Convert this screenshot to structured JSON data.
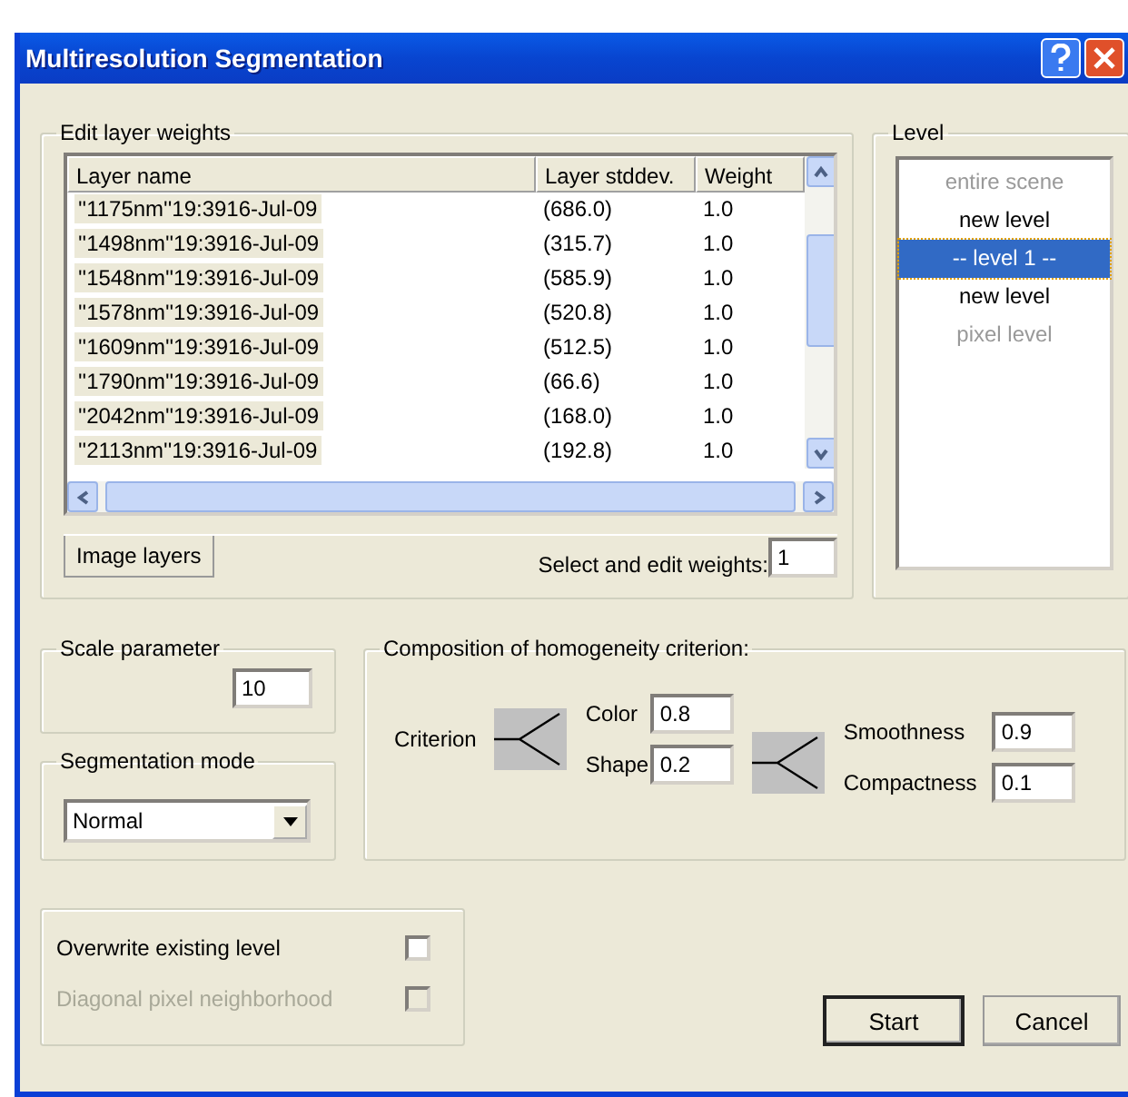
{
  "window": {
    "title": "Multiresolution Segmentation"
  },
  "layer_weights": {
    "title": "Edit layer weights",
    "columns": [
      "Layer name",
      "Layer stddev.",
      "Weight"
    ],
    "rows": [
      {
        "name": "''1175nm''19:3916-Jul-09",
        "stddev": "(686.0)",
        "weight": "1.0"
      },
      {
        "name": "''1498nm''19:3916-Jul-09",
        "stddev": "(315.7)",
        "weight": "1.0"
      },
      {
        "name": "''1548nm''19:3916-Jul-09",
        "stddev": "(585.9)",
        "weight": "1.0"
      },
      {
        "name": "''1578nm''19:3916-Jul-09",
        "stddev": "(520.8)",
        "weight": "1.0"
      },
      {
        "name": "''1609nm''19:3916-Jul-09",
        "stddev": "(512.5)",
        "weight": "1.0"
      },
      {
        "name": "''1790nm''19:3916-Jul-09",
        "stddev": "(66.6)",
        "weight": "1.0"
      },
      {
        "name": "''2042nm''19:3916-Jul-09",
        "stddev": "(168.0)",
        "weight": "1.0"
      },
      {
        "name": "''2113nm''19:3916-Jul-09",
        "stddev": "(192.8)",
        "weight": "1.0"
      }
    ],
    "tab": {
      "label": "Image layers",
      "selected": true
    },
    "edit_label": "Select and edit weights:",
    "edit_value": "1"
  },
  "level": {
    "title": "Level",
    "items": [
      {
        "label": "entire scene",
        "selected": false,
        "disabled": true
      },
      {
        "label": "new level",
        "selected": false,
        "disabled": false
      },
      {
        "label": "-- level 1 --",
        "selected": true,
        "disabled": false
      },
      {
        "label": "new level",
        "selected": false,
        "disabled": false
      },
      {
        "label": "pixel level",
        "selected": false,
        "disabled": true
      }
    ]
  },
  "scale_parameter": {
    "title": "Scale parameter",
    "value": "10"
  },
  "segmentation_mode": {
    "title": "Segmentation mode",
    "value": "Normal"
  },
  "composition": {
    "title": "Composition of homogeneity criterion:",
    "criterion_label": "Criterion",
    "color": {
      "label": "Color",
      "value": "0.8"
    },
    "shape": {
      "label": "Shape",
      "value": "0.2"
    },
    "smoothness": {
      "label": "Smoothness",
      "value": "0.9"
    },
    "compactness": {
      "label": "Compactness",
      "value": "0.1"
    }
  },
  "options": [
    {
      "label": "Overwrite existing level",
      "checked": false,
      "disabled": false
    },
    {
      "label": "Diagonal pixel neighborhood",
      "checked": false,
      "disabled": true
    }
  ],
  "buttons": [
    {
      "label": "Start",
      "default": true
    },
    {
      "label": "Cancel",
      "default": false
    }
  ]
}
